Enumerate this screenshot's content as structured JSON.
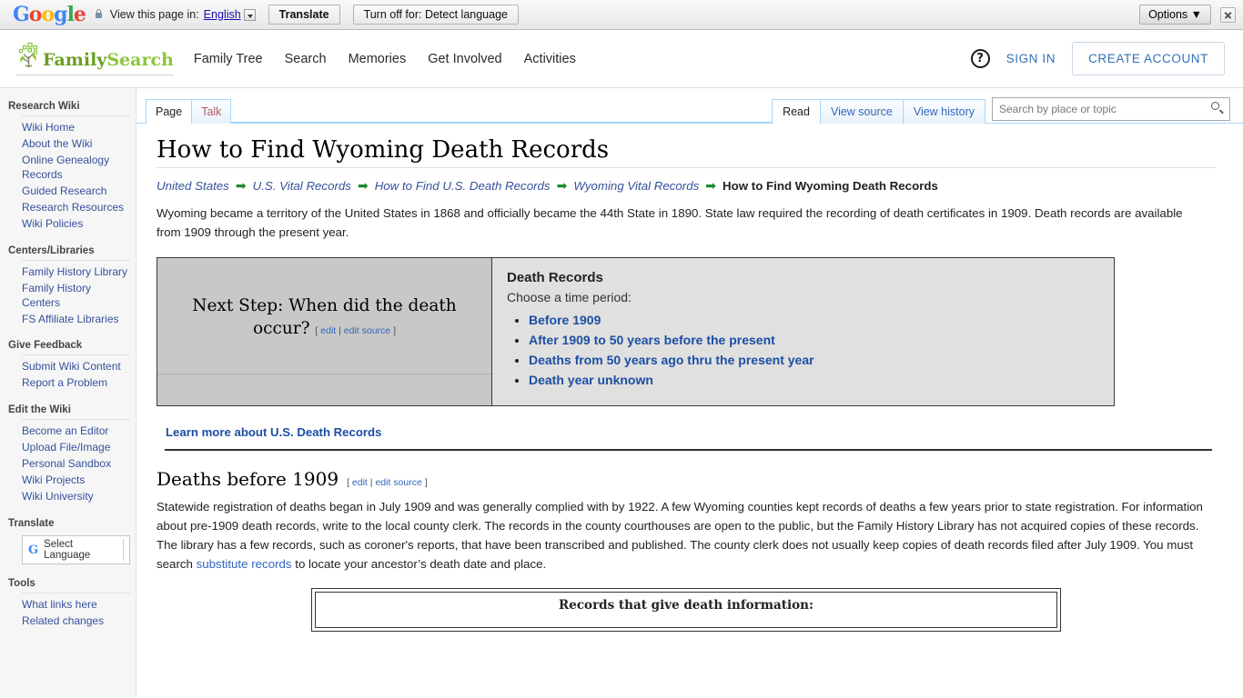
{
  "translate_bar": {
    "logo_letters": [
      "G",
      "o",
      "o",
      "g",
      "l",
      "e"
    ],
    "lock_icon": "lock-icon",
    "view_label": "View this page in:",
    "language": "English",
    "translate_button": "Translate",
    "turn_off_button": "Turn off for: Detect language",
    "options_button": "Options ▼",
    "close_icon": "close-icon"
  },
  "header": {
    "brand_a": "Family",
    "brand_b": "Search",
    "nav": [
      "Family Tree",
      "Search",
      "Memories",
      "Get Involved",
      "Activities"
    ],
    "help_icon": "?",
    "sign_in": "SIGN IN",
    "create_account": "CREATE ACCOUNT"
  },
  "sidebar": {
    "sections": [
      {
        "title": "Research Wiki",
        "items": [
          "Wiki Home",
          "About the Wiki",
          "Online Genealogy Records",
          "Guided Research",
          "Research Resources",
          "Wiki Policies"
        ]
      },
      {
        "title": "Centers/Libraries",
        "items": [
          "Family History Library",
          "Family History Centers",
          "FS Affiliate Libraries"
        ]
      },
      {
        "title": "Give Feedback",
        "items": [
          "Submit Wiki Content",
          "Report a Problem"
        ]
      },
      {
        "title": "Edit the Wiki",
        "items": [
          "Become an Editor",
          "Upload File/Image",
          "Personal Sandbox",
          "Wiki Projects",
          "Wiki University"
        ]
      }
    ],
    "translate_title": "Translate",
    "select_language": "Select Language",
    "google_g": "G",
    "tools_title": "Tools",
    "tools_items": [
      "What links here",
      "Related changes"
    ]
  },
  "tabs": {
    "left": [
      {
        "label": "Page",
        "active": true
      },
      {
        "label": "Talk",
        "active": false
      }
    ],
    "right": [
      {
        "label": "Read",
        "active": true
      },
      {
        "label": "View source",
        "active": false
      },
      {
        "label": "View history",
        "active": false
      }
    ],
    "search_placeholder": "Search by place or topic",
    "search_value": "",
    "search_icon": "search-icon"
  },
  "article": {
    "title": "How to Find Wyoming Death Records",
    "breadcrumb": [
      "United States",
      "U.S. Vital Records",
      "How to Find U.S. Death Records",
      "Wyoming Vital Records"
    ],
    "breadcrumb_current": "How to Find Wyoming Death Records",
    "breadcrumb_arrow": "➡",
    "lead": "Wyoming became a territory of the United States in 1868 and officially became the 44th State in 1890. State law required the recording of death certificates in 1909. Death records are available from 1909 through the present year.",
    "next_step": {
      "heading": "Next Step: When did the death occur?",
      "edit_open": "[",
      "edit": "edit",
      "edit_sep": "|",
      "edit_source": "edit source",
      "edit_close": "]"
    },
    "death_records": {
      "heading": "Death Records",
      "subheading": "Choose a time period:",
      "options": [
        "Before 1909",
        "After 1909 to 50 years before the present",
        "Deaths from 50 years ago thru the present year",
        "Death year unknown"
      ]
    },
    "learn_more": "Learn more about U.S. Death Records",
    "section": {
      "heading": "Deaths before 1909",
      "edit_open": "[",
      "edit": "edit",
      "edit_sep": "|",
      "edit_source": "edit source",
      "edit_close": "]",
      "paragraph_part1": "Statewide registration of deaths began in July 1909 and was generally complied with by 1922. A few Wyoming counties kept records of deaths a few years prior to state registration. For information about pre-1909 death records, write to the local county clerk. The records in the county courthouses are open to the public, but the Family History Library has not acquired copies of these records. The library has a few records, such as coroner's reports, that have been transcribed and published. The county clerk does not usually keep copies of death records filed after July 1909. You must search ",
      "paragraph_link": "substitute records",
      "paragraph_part2": " to locate your ancestor’s death date and place."
    },
    "records_box_title": "Records that give death information:"
  },
  "colors": {
    "link_blue": "#36519b",
    "strong_link_blue": "#1c4ea3",
    "tab_blue": "#a7d7f9",
    "brand_green_dark": "#6d9e23",
    "brand_green_light": "#8cc63e",
    "arrow_green": "#1a8b2b",
    "panel_left_bg": "#c8c8c8",
    "panel_right_bg": "#e0e0e0"
  }
}
